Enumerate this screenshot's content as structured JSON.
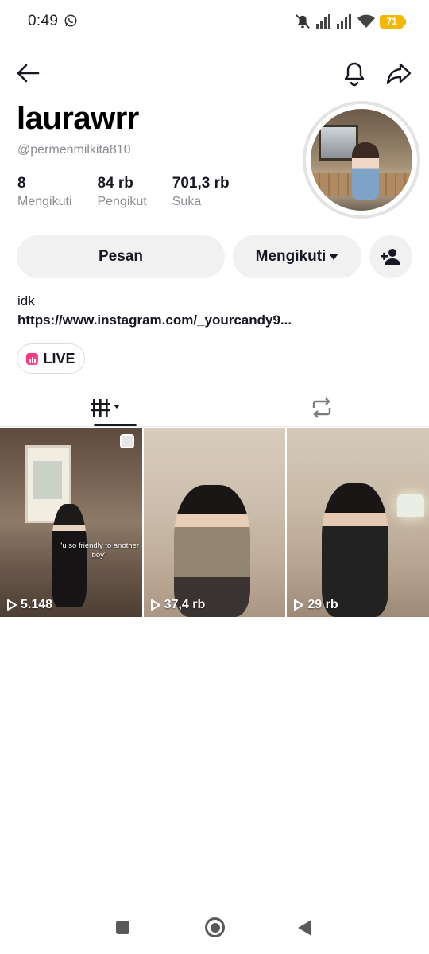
{
  "status_bar": {
    "time": "0:49",
    "battery": "71",
    "icons": [
      "whatsapp-icon",
      "mute-icon",
      "signal-icon",
      "signal-icon",
      "wifi-icon",
      "battery-icon"
    ]
  },
  "nav": {
    "icons": [
      "arrow-left-icon",
      "bell-icon",
      "share-icon"
    ]
  },
  "profile": {
    "display_name": "laurawrr",
    "username": "@permenmilkita810",
    "stats": [
      {
        "value": "8",
        "label": "Mengikuti"
      },
      {
        "value": "84 rb",
        "label": "Pengikut"
      },
      {
        "value": "701,3 rb",
        "label": "Suka"
      }
    ],
    "bio": "idk",
    "link": "https://www.instagram.com/_yourcandy9..."
  },
  "actions": {
    "message_label": "Pesan",
    "following_label": "Mengikuti",
    "add_friend_icon": "add-user-icon"
  },
  "live_label": "LIVE",
  "tabs": {
    "videos_icon": "grid-columns-icon",
    "reposts_icon": "repost-icon",
    "active": "videos"
  },
  "videos": [
    {
      "views": "5.148",
      "caption": "\"u so friendly to another boy\""
    },
    {
      "views": "37,4 rb"
    },
    {
      "views": "29 rb"
    }
  ],
  "colors": {
    "text_primary": "#161823",
    "text_secondary": "#8a8b91",
    "button_bg": "#f1f1f2",
    "battery": "#f5b800",
    "live_accent": "#ff2d73"
  }
}
